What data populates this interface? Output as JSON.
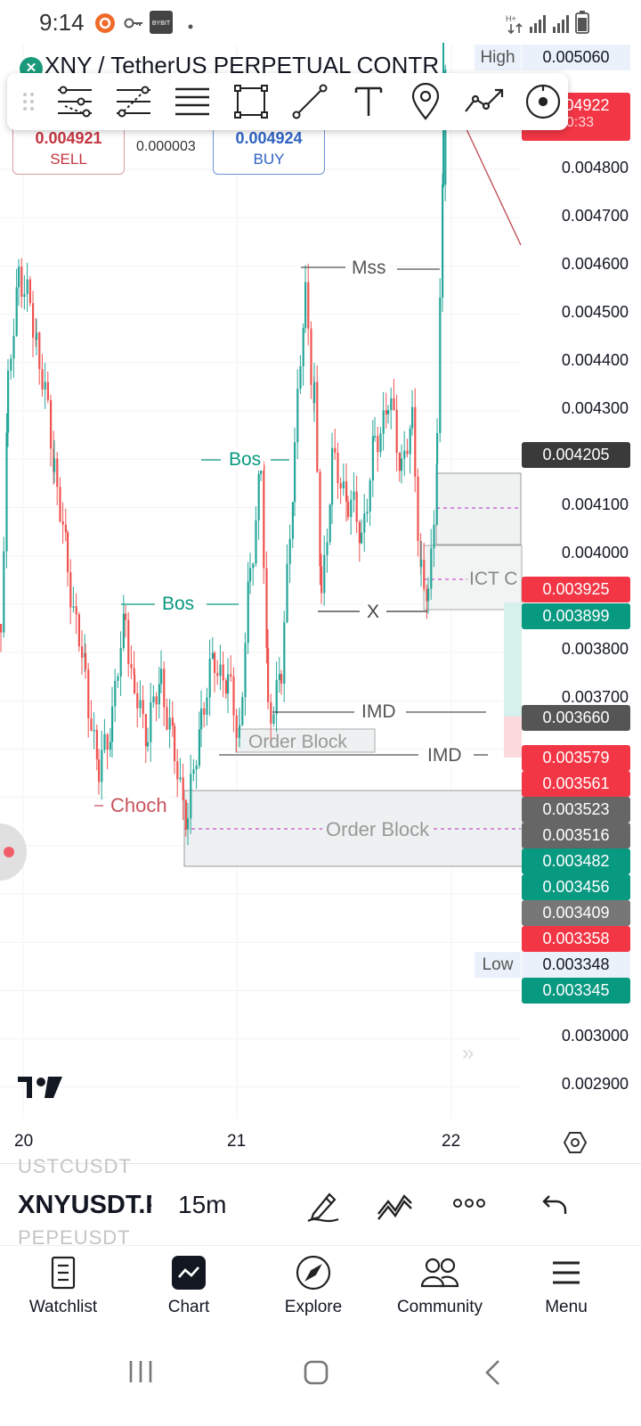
{
  "status_bar": {
    "time": "9:14",
    "app_badge": "BYBIT"
  },
  "symbol": {
    "title": "XNY / TetherUS PERPETUAL CONTR"
  },
  "toolbar": {
    "tools": [
      "drag-handle-icon",
      "trend-tools-icon",
      "fib-tools-icon",
      "horizontal-lines-icon",
      "rectangle-icon",
      "line-icon",
      "text-icon",
      "pin-icon",
      "path-icon",
      "cursor-icon"
    ]
  },
  "trade": {
    "sell_price": "0.004921",
    "sell_label": "SELL",
    "spread": "0.000003",
    "buy_price": "0.004924",
    "buy_label": "BUY"
  },
  "price_axis": {
    "high_label": "High",
    "high_value": "0.005060",
    "low_label": "Low",
    "low_value": "0.003348",
    "current_price": "0.004922",
    "current_countdown": "00:33",
    "ticks": [
      "0.004800",
      "0.004700",
      "0.004600",
      "0.004500",
      "0.004400",
      "0.004300",
      "0.004100",
      "0.004000",
      "0.003800",
      "0.003700",
      "0.003000",
      "0.002900"
    ],
    "tags": [
      {
        "value": "0.004205",
        "color": "#3a3a3a"
      },
      {
        "value": "0.003925",
        "color": "#f23645"
      },
      {
        "value": "0.003899",
        "color": "#089981"
      },
      {
        "value": "0.003660",
        "color": "#555555"
      },
      {
        "value": "0.003579",
        "color": "#f23645"
      },
      {
        "value": "0.003561",
        "color": "#f23645"
      },
      {
        "value": "0.003523",
        "color": "#666666"
      },
      {
        "value": "0.003516",
        "color": "#666666"
      },
      {
        "value": "0.003482",
        "color": "#089981"
      },
      {
        "value": "0.003456",
        "color": "#089981"
      },
      {
        "value": "0.003409",
        "color": "#777777"
      },
      {
        "value": "0.003358",
        "color": "#f23645"
      },
      {
        "value": "0.003345",
        "color": "#089981"
      }
    ]
  },
  "annotations": {
    "mss": "Mss",
    "bos_upper": "Bos",
    "bos_lower": "Bos",
    "x_mark": "X",
    "ict": "ICT C",
    "imd_upper": "IMD",
    "imd_lower": "IMD",
    "order_block_upper": "Order Block",
    "order_block_lower": "Order Block",
    "choch": "Choch"
  },
  "time_axis": {
    "labels": [
      "20",
      "21",
      "22"
    ]
  },
  "footer": {
    "ticker_above": "USTCUSDT",
    "ticker_current": "XNYUSDT.P",
    "ticker_below": "PEPEUSDT",
    "interval": "15m"
  },
  "bottom_nav": {
    "watchlist": "Watchlist",
    "chart": "Chart",
    "explore": "Explore",
    "community": "Community",
    "menu": "Menu"
  },
  "colors": {
    "up": "#26a69a",
    "down": "#ef5350",
    "accent_teal": "#089981",
    "accent_red": "#f23645"
  }
}
